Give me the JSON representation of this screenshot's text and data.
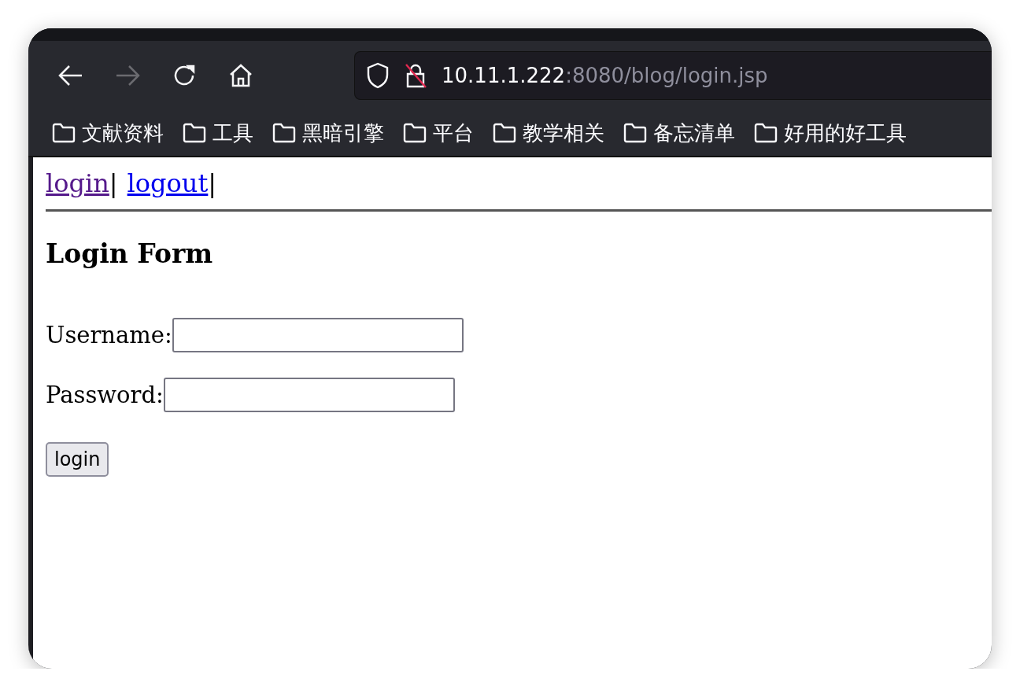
{
  "toolbar": {
    "buttons": [
      {
        "kind": "back",
        "disabled": false
      },
      {
        "kind": "forward",
        "disabled": true
      },
      {
        "kind": "reload",
        "disabled": false
      },
      {
        "kind": "home",
        "disabled": false
      }
    ]
  },
  "address_bar": {
    "host": "10.11.1.222",
    "rest": ":8080/blog/login.jsp"
  },
  "bookmarks": [
    {
      "label": "文献资料"
    },
    {
      "label": "工具"
    },
    {
      "label": "黑暗引擎"
    },
    {
      "label": "平台"
    },
    {
      "label": "教学相关"
    },
    {
      "label": "备忘清单"
    },
    {
      "label": "好用的好工具"
    }
  ],
  "nav_links": [
    {
      "label": "login",
      "visited": true,
      "separator": "|"
    },
    {
      "label": "logout",
      "visited": false,
      "separator": "|"
    }
  ],
  "heading": "Login Form",
  "fields": [
    {
      "label": "Username:"
    },
    {
      "label": "Password:"
    }
  ],
  "submit": "login"
}
